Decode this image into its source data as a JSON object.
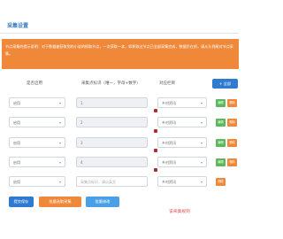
{
  "page": {
    "title": "采集设置"
  },
  "notice": {
    "text": "节点采集的提示说明：对于数据被获取到的小说的抓取节点，一次获取一本，如抓取过节点已全部采集完成，数据仍在抓，请从头到尾对节点采集。"
  },
  "columns": {
    "status": "是否启用",
    "identifier": "采集点标识（唯一，字母+数字）",
    "target": "对应栏目"
  },
  "buttons": {
    "add": "+ 全部",
    "edit": "编辑",
    "delete": "删除",
    "save": "提交保存",
    "batch_delete": "批量选取采集",
    "batch_edit": "批量修改"
  },
  "rows": [
    {
      "status": "启用",
      "identifier": "1",
      "target": "乡村资讯",
      "placeholder": "",
      "buttons": [
        "edit",
        "delete"
      ]
    },
    {
      "status": "启用",
      "identifier": "2",
      "target": "乡村资讯",
      "placeholder": "",
      "buttons": [
        "edit",
        "delete"
      ]
    },
    {
      "status": "启用",
      "identifier": "3",
      "target": "乡村资讯",
      "placeholder": "",
      "buttons": [
        "edit",
        "delete"
      ]
    },
    {
      "status": "启用",
      "identifier": "4",
      "target": "乡村资讯",
      "placeholder": "",
      "buttons": [
        "edit",
        "delete"
      ]
    },
    {
      "status": "启用",
      "identifier": "",
      "target": "乡村资讯",
      "placeholder": "采集点标识，请以英文",
      "buttons": [
        "delete"
      ]
    }
  ],
  "red_note": "该采集规则",
  "colors": {
    "accent_blue": "#2f7bd1",
    "notice_orange": "#f0883a",
    "green": "#5cb85c",
    "title_blue": "#3a7ec2"
  }
}
